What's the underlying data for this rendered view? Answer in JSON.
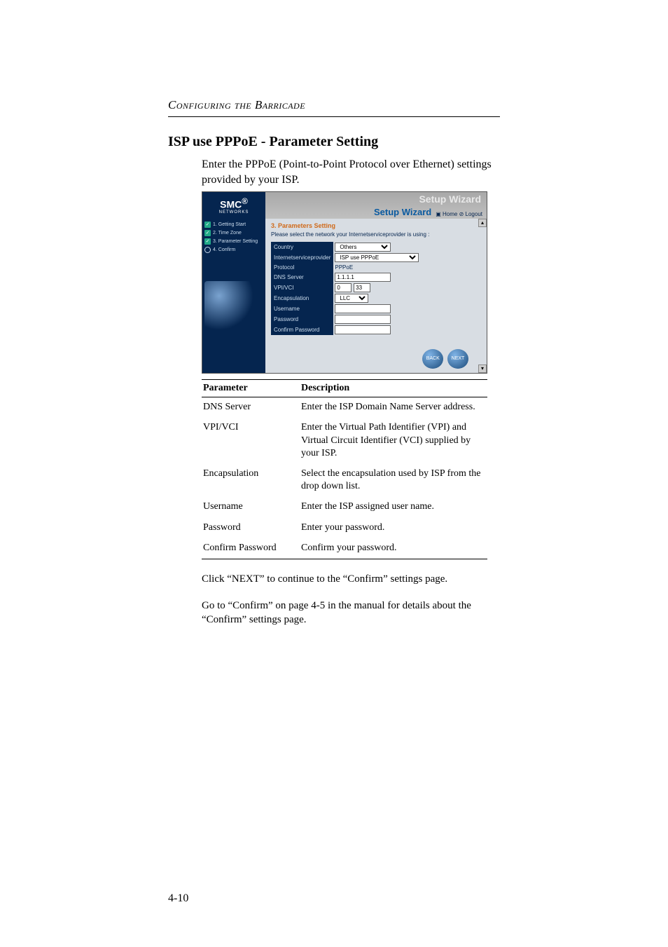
{
  "header": {
    "running": "Configuring the Barricade"
  },
  "title": "ISP use PPPoE - Parameter Setting",
  "intro": "Enter the PPPoE (Point-to-Point Protocol over Ethernet) settings provided by your ISP.",
  "screenshot": {
    "logo_big": "SMC",
    "logo_small": "NETWORKS",
    "logo_sup": "®",
    "main_title": "Setup Wizard",
    "sub_title": "Setup Wizard",
    "link_home": "Home",
    "link_logout": "Logout",
    "side": {
      "i1": "1. Getting Start",
      "i2": "2. Time Zone",
      "i3": "3. Parameter Setting",
      "i4": "4. Confirm"
    },
    "panel_title": "3. Parameters Setting",
    "panel_sub": "Please select the network your Internetserviceprovider is using :",
    "labels": {
      "country": "Country",
      "isp": "Internetserviceprovider",
      "protocol": "Protocol",
      "dns": "DNS Server",
      "vpi": "VPI/VCI",
      "encap": "Encapsulation",
      "user": "Username",
      "pass": "Password",
      "conf": "Confirm Password"
    },
    "values": {
      "country": "Others",
      "isp": "ISP use PPPoE",
      "protocol": "PPPoE",
      "dns": "1.1.1.1",
      "vpi_a": "0",
      "vpi_b": "33",
      "encap": "LLC",
      "user": "",
      "pass": "",
      "conf": ""
    },
    "btn_back": "BACK",
    "btn_next": "NEXT"
  },
  "table": {
    "h1": "Parameter",
    "h2": "Description",
    "rows": {
      "r0": {
        "p": "DNS Server",
        "d": "Enter the ISP Domain Name Server address."
      },
      "r1": {
        "p": "VPI/VCI",
        "d": "Enter the Virtual Path Identifier (VPI) and Virtual Circuit Identifier (VCI) supplied by your ISP."
      },
      "r2": {
        "p": "Encapsulation",
        "d": "Select the encapsulation used by ISP from the drop down list."
      },
      "r3": {
        "p": "Username",
        "d": "Enter the ISP assigned user name."
      },
      "r4": {
        "p": "Password",
        "d": "Enter your password."
      },
      "r5": {
        "p": "Confirm Password",
        "d": "Confirm your password."
      }
    }
  },
  "body1": "Click “NEXT” to continue to the “Confirm” settings page.",
  "body2": "Go to “Confirm” on page 4-5 in the manual for details about the “Confirm” settings page.",
  "page_number": "4-10"
}
